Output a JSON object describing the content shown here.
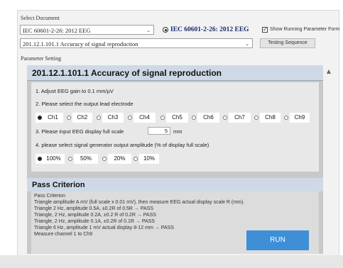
{
  "header": {
    "select_document_label": "Select Document",
    "standard_select_value": "IEC 60601-2-26: 2012 EEG",
    "selected_standard_label": "IEC 60601-2-26: 2012 EEG",
    "clause_select_value": "201.12.1.101.1   Accuracy of signal reproduction",
    "show_running_parameter_label": "Show Running Parameter Form",
    "testing_sequence_label": "Testing Sequence",
    "parameter_setting_label": "Parameter Setting"
  },
  "panel": {
    "title": "201.12.1.101.1 Accuracy of signal reproduction",
    "step1": "1. Adjust EEG gain to 0.1 mm/μV",
    "step2": "2. Please select the output lead electrode",
    "channels": [
      "Ch1",
      "Ch2",
      "Ch3",
      "Ch4",
      "Ch5",
      "Ch6",
      "Ch7",
      "Ch8",
      "Ch9"
    ],
    "selected_channel": "Ch1",
    "step3_prefix": "3. Please input EEG display full scale",
    "fullscale_value": "5",
    "step3_unit": "mm",
    "step4": "4. please select signal generator output amplitude (% of display full scale)",
    "amplitudes": [
      "100%",
      "50%",
      "20%",
      "10%"
    ],
    "selected_amplitude": "100%"
  },
  "pass": {
    "title": "Pass Criterion",
    "lines": [
      "Pass Criterion",
      "Triangle amplitude  A mV (full scale x 0.01 mV), then measure EEG actual display scale R (mm).",
      "Triangle  2 Hz, amplitude  0.5A, ±0.2R of 0.5R → PASS",
      "Triangle, 2 Hz, amplitude  0.2A, ±0.2 R of 0.2R → PASS",
      "Triangle, 2 Hz, amplitude  0.1A, ±0.2R of 0.1R → PASS",
      "Triangle  6 Hz, amplitude  1 mV  actual display 8-12 mm → PASS",
      "Measure channel 1 to Ch9"
    ]
  },
  "run_label": "RUN",
  "colors": {
    "accent": "#3e8fd6",
    "panel_header": "#cfd9e6",
    "panel_bg": "#c8c8c8"
  }
}
